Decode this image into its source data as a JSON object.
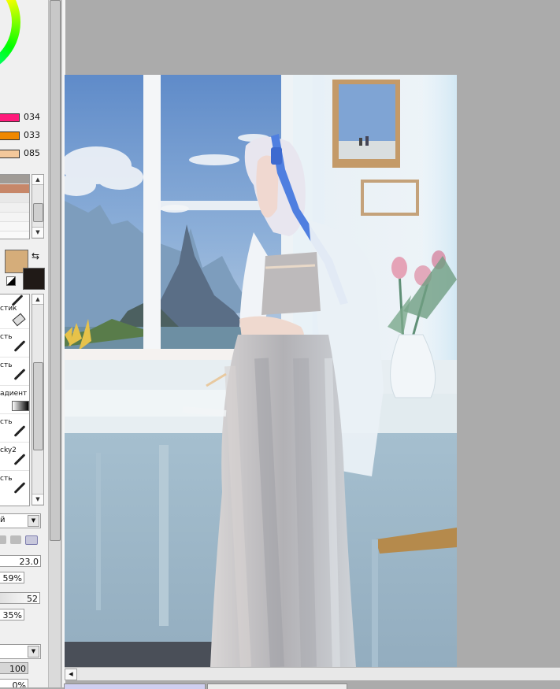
{
  "color_sliders": [
    {
      "value": "034",
      "color": "#ff1a7a"
    },
    {
      "value": "033",
      "color": "#f08800"
    },
    {
      "value": "085",
      "color": "#f3c89b"
    }
  ],
  "swatches": [
    "#a09b96",
    "#c78769",
    "#e8e8e8",
    "#f0f0f0",
    "#f4f4f4",
    "#f7f7f7"
  ],
  "colors": {
    "foreground": "#d5ad7a",
    "background": "#201a17"
  },
  "tools": [
    {
      "label": "стик"
    },
    {
      "label": "сть"
    },
    {
      "label": "сть"
    },
    {
      "label": "адиент"
    },
    {
      "label": "сть"
    },
    {
      "label": "cky2"
    },
    {
      "label": "сть"
    }
  ],
  "blend_mode": {
    "label": "й"
  },
  "brush": {
    "size": "23.0",
    "density": "59%",
    "min_size_value": "52",
    "min_density": "35%",
    "quality": "100",
    "smoothing": "0%"
  }
}
